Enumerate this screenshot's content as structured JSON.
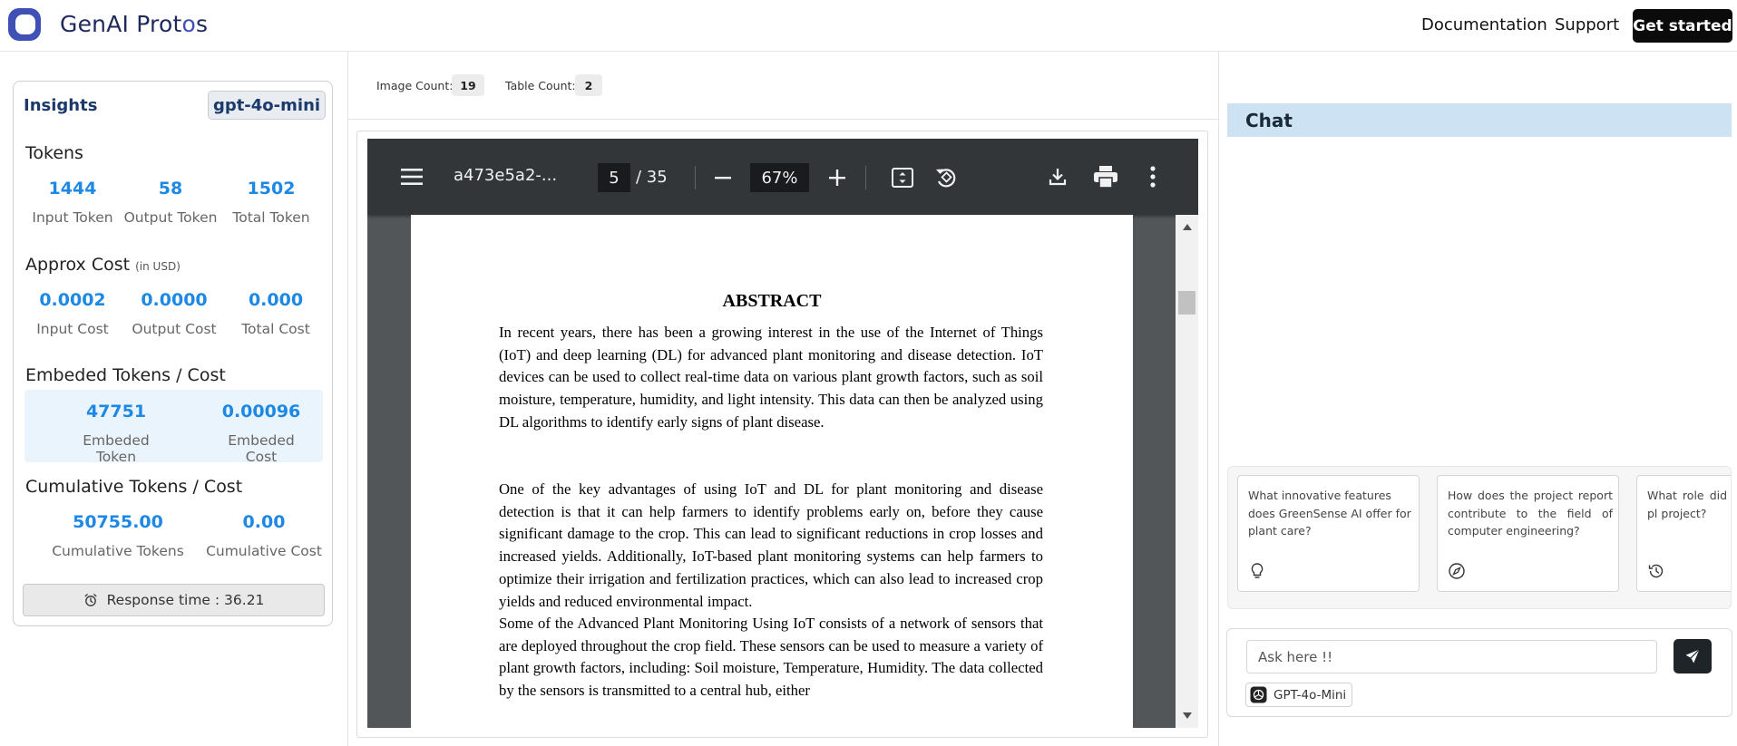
{
  "header": {
    "brand_main": "GenAI Prot",
    "brand_accent": "o",
    "brand_tail": "s",
    "nav": {
      "documentation": "Documentation",
      "support": "Support",
      "get_started": "Get started"
    }
  },
  "insights": {
    "title": "Insights",
    "model": "gpt-4o-mini",
    "tokens": {
      "title": "Tokens",
      "input_value": "1444",
      "input_label": "Input Token",
      "output_value": "58",
      "output_label": "Output Token",
      "total_value": "1502",
      "total_label": "Total Token"
    },
    "cost": {
      "title": "Approx Cost",
      "unit": "(in USD)",
      "input_value": "0.0002",
      "input_label": "Input Cost",
      "output_value": "0.0000",
      "output_label": "Output Cost",
      "total_value": "0.000",
      "total_label": "Total Cost"
    },
    "embedded": {
      "title": "Embeded Tokens / Cost",
      "token_value": "47751",
      "token_label": "Embeded Token",
      "cost_value": "0.00096",
      "cost_label": "Embeded Cost"
    },
    "cumulative": {
      "title": "Cumulative Tokens / Cost",
      "token_value": "50755.00",
      "token_label": "Cumulative Tokens",
      "cost_value": "0.00",
      "cost_label": "Cumulative Cost"
    },
    "response_time": "Response time : 36.21"
  },
  "counts": {
    "image_label": "Image Count:",
    "image_value": "19",
    "table_label": "Table Count:",
    "table_value": "2"
  },
  "pdf": {
    "filename": "a473e5a2-...",
    "page": "5",
    "total_pages": "/ 35",
    "zoom": "67%",
    "heading": "ABSTRACT",
    "paragraphs": [
      "In recent years, there has been a growing interest in the use of the Internet of Things (IoT) and deep learning (DL) for advanced plant monitoring and disease detection. IoT devices can be used to collect real-time data on various plant growth factors, such as soil moisture, temperature, humidity, and light intensity. This data can then be analyzed using DL algorithms to identify early signs of plant disease.",
      "One of the key advantages of using IoT and DL for plant monitoring and disease detection is that it can help farmers to identify problems early on, before they cause significant damage to the crop. This can lead to significant reductions in crop losses and increased yields. Additionally, IoT-based plant monitoring systems can help farmers to optimize their irrigation and fertilization practices, which can also lead to increased crop yields and reduced environmental impact.",
      "Some of the Advanced Plant Monitoring Using IoT consists of a network of sensors that are deployed throughout the crop field. These sensors can be used to measure a variety of plant growth factors, including: Soil moisture, Temperature, Humidity. The data collected by the sensors is transmitted to a central hub, either"
    ]
  },
  "chat": {
    "title": "Chat",
    "suggestions": [
      {
        "text": "What innovative features does GreenSense AI offer for plant care?",
        "icon": "lightbulb-icon"
      },
      {
        "text": "How does the project report contribute to the field of computer engineering?",
        "icon": "compass-icon"
      },
      {
        "text": "What role did Pr Mukhedkar pl project?",
        "icon": "history-icon"
      }
    ],
    "input_placeholder": "Ask here !!",
    "model_chip": "GPT-4o-Mini"
  },
  "colors": {
    "accent_blue": "#1e88e5",
    "navy": "#1b3a6b",
    "chat_header": "#cde3f3",
    "pdf_toolbar": "#323639",
    "pdf_background": "#525659"
  }
}
